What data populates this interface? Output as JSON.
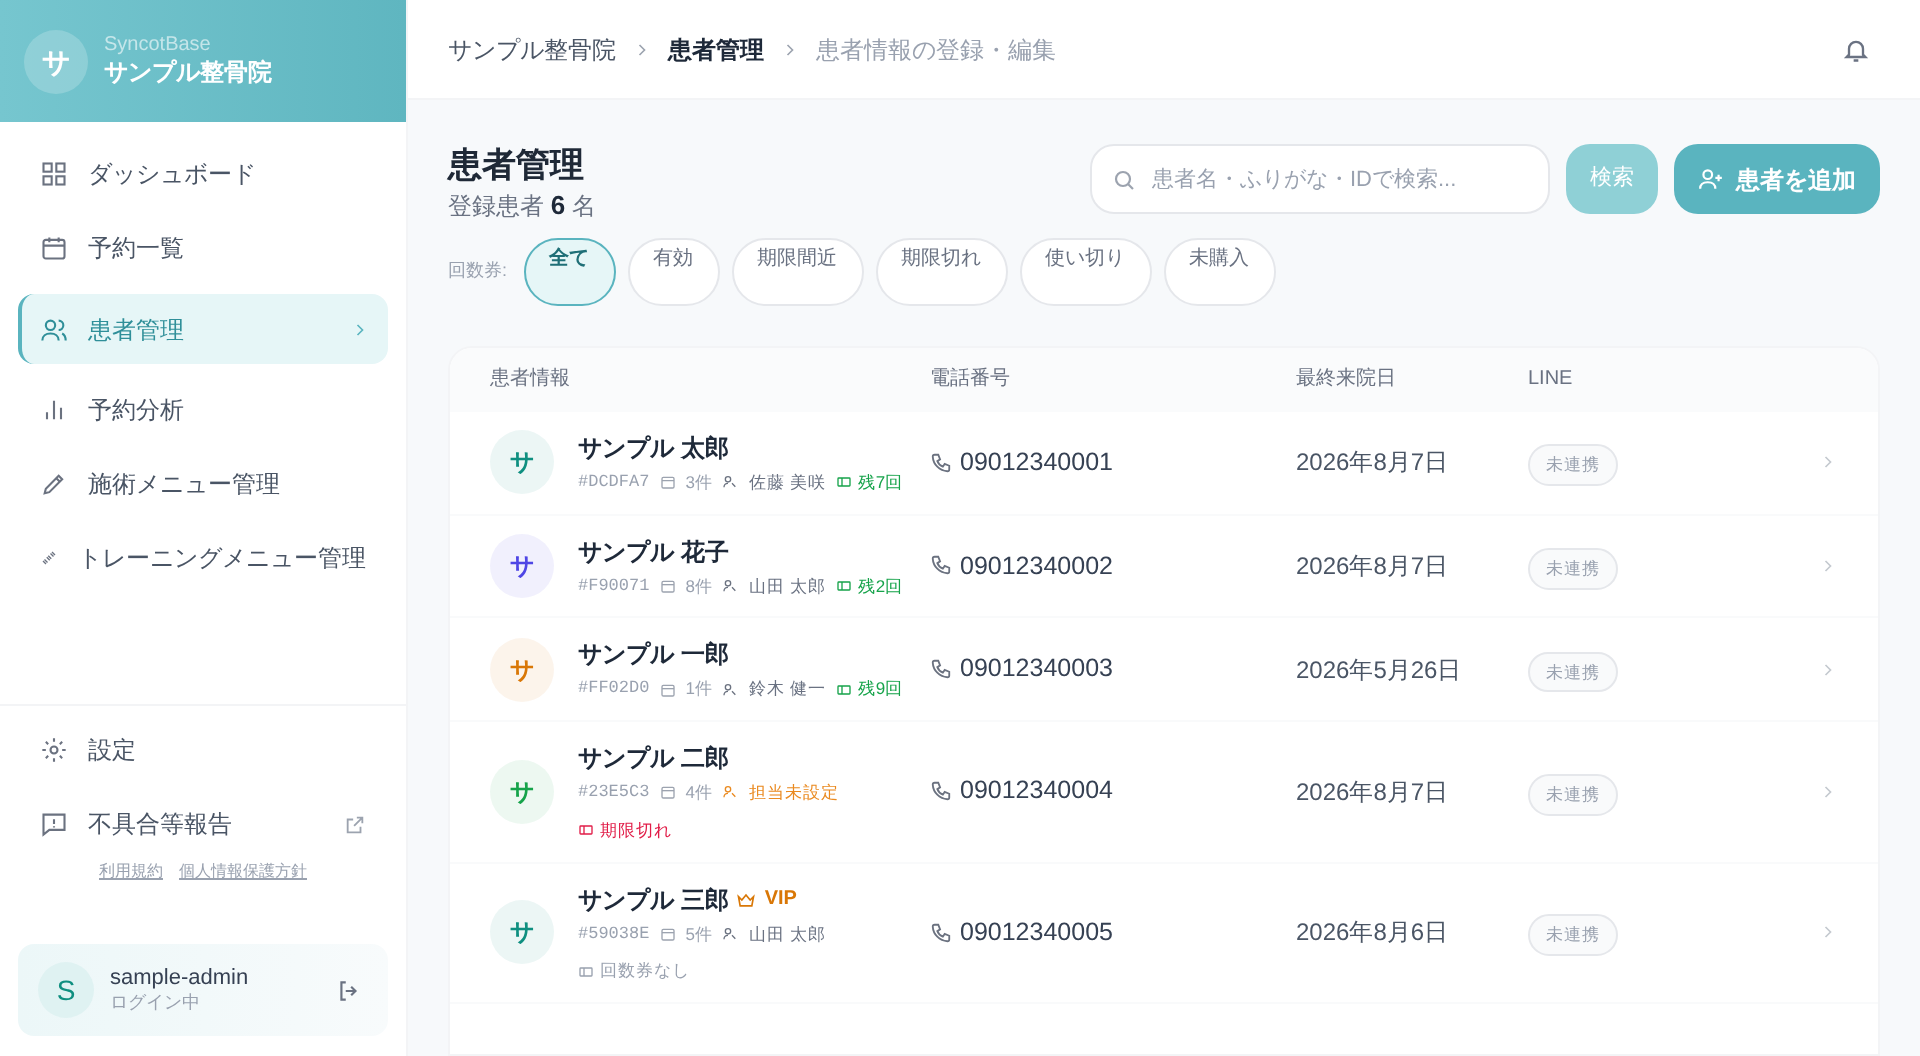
{
  "brand": {
    "logo_letter": "サ",
    "product": "SyncotBase",
    "clinic": "サンプル整骨院"
  },
  "nav": [
    {
      "label": "ダッシュボード",
      "selected": false
    },
    {
      "label": "予約一覧",
      "selected": false
    },
    {
      "label": "患者管理",
      "selected": true
    },
    {
      "label": "予約分析",
      "selected": false
    },
    {
      "label": "施術メニュー管理",
      "selected": false
    },
    {
      "label": "トレーニングメニュー管理",
      "selected": false
    }
  ],
  "footer_nav": [
    {
      "label": "設定",
      "external": false
    },
    {
      "label": "不具合等報告",
      "external": true
    }
  ],
  "footer_links": [
    "利用規約",
    "個人情報保護方針"
  ],
  "user": {
    "initial": "S",
    "name": "sample-admin",
    "status": "ログイン中"
  },
  "breadcrumb": [
    "サンプル整骨院",
    "患者管理",
    "患者情報の登録・編集"
  ],
  "page": {
    "title": "患者管理",
    "count_prefix": "登録患者",
    "count": "6",
    "count_suffix": "名"
  },
  "search": {
    "placeholder": "患者名・ふりがな・IDで検索...",
    "button": "検索",
    "add_button": "患者を追加"
  },
  "filter": {
    "label": "回数券:",
    "chips": [
      {
        "label": "全て",
        "selected": true
      },
      {
        "label": "有効",
        "selected": false
      },
      {
        "label": "期限間近",
        "selected": false
      },
      {
        "label": "期限切れ",
        "selected": false
      },
      {
        "label": "使い切り",
        "selected": false
      },
      {
        "label": "未購入",
        "selected": false
      }
    ]
  },
  "table": {
    "columns": [
      "患者情報",
      "電話番号",
      "最終来院日",
      "LINE"
    ],
    "rows": [
      {
        "initial": "サ",
        "color": "#0f8f80",
        "name": "サンプル 太郎",
        "id": "#DCDFA7",
        "visits": "3件",
        "staff": {
          "kind": "assigned",
          "text": "佐藤 美咲"
        },
        "ticket": {
          "kind": "remaining",
          "text": "残7回"
        },
        "phone": "09012340001",
        "last_visit": "2026年8月7日",
        "line": "未連携"
      },
      {
        "initial": "サ",
        "color": "#4f46e5",
        "name": "サンプル 花子",
        "id": "#F90071",
        "visits": "8件",
        "staff": {
          "kind": "assigned",
          "text": "山田 太郎"
        },
        "ticket": {
          "kind": "remaining",
          "text": "残2回"
        },
        "phone": "09012340002",
        "last_visit": "2026年8月7日",
        "line": "未連携"
      },
      {
        "initial": "サ",
        "color": "#d97706",
        "name": "サンプル 一郎",
        "id": "#FF02D0",
        "visits": "1件",
        "staff": {
          "kind": "assigned",
          "text": "鈴木 健一"
        },
        "ticket": {
          "kind": "remaining",
          "text": "残9回"
        },
        "phone": "09012340003",
        "last_visit": "2026年5月26日",
        "line": "未連携"
      },
      {
        "initial": "サ",
        "color": "#16a34a",
        "name": "サンプル 二郎",
        "id": "#23E5C3",
        "visits": "4件",
        "staff": {
          "kind": "unassigned",
          "text": "担当未設定"
        },
        "ticket": {
          "kind": "expired",
          "text": "期限切れ"
        },
        "phone": "09012340004",
        "last_visit": "2026年8月7日",
        "line": "未連携"
      },
      {
        "initial": "サ",
        "color": "#0f8f80",
        "name": "サンプル 三郎",
        "vip": "VIP",
        "id": "#59038E",
        "visits": "5件",
        "staff": {
          "kind": "assigned",
          "text": "山田 太郎"
        },
        "ticket": {
          "kind": "none",
          "text": "回数券なし"
        },
        "phone": "09012340005",
        "last_visit": "2026年8月6日",
        "line": "未連携"
      }
    ]
  }
}
